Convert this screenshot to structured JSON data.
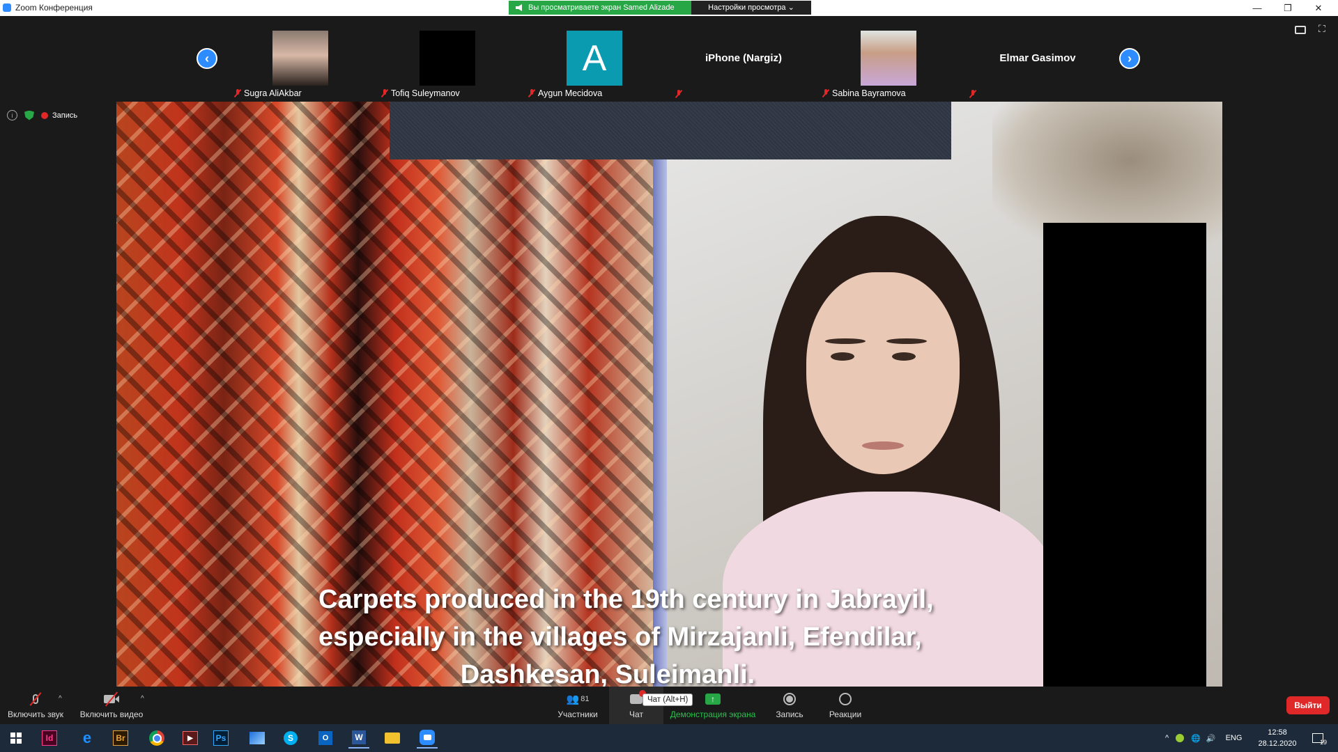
{
  "window": {
    "title": "Zoom Конференция",
    "controls": {
      "minimize": "—",
      "restore": "❐",
      "close": "✕"
    }
  },
  "share_banner": {
    "status": "Вы просматриваете экран Samed Alizade",
    "view_options": "Настройки просмотра ⌄"
  },
  "gallery": {
    "participants": [
      {
        "name": "Sugra AliAkbar",
        "type": "photo"
      },
      {
        "name": "Tofiq Suleymanov",
        "type": "black"
      },
      {
        "name": "Aygun Mecidova",
        "type": "avatar",
        "initial": "A"
      },
      {
        "name": "",
        "big_label": "iPhone (Nargiz)",
        "type": "label"
      },
      {
        "name": "Sabina Bayramova",
        "type": "photo"
      },
      {
        "name": "",
        "big_label": "Elmar Gasimov",
        "type": "label"
      }
    ]
  },
  "status_row": {
    "recording": "Запись"
  },
  "shared_content": {
    "caption_lines": [
      "Carpets produced in the 19th century in Jabrayil,",
      "especially in the villages of Mirzajanli, Efendilar,",
      "Dashkesan, Suleimanli."
    ]
  },
  "toolbar": {
    "unmute": "Включить звук",
    "start_video": "Включить видео",
    "participants": "Участники",
    "participants_count": "81",
    "chat": "Чат",
    "chat_tooltip": "Чат (Alt+H)",
    "share_screen": "Демонстрация экрана",
    "record": "Запись",
    "reactions": "Реакции",
    "leave": "Выйти"
  },
  "taskbar": {
    "apps": [
      "Id",
      "e",
      "Br",
      "Ps",
      "W"
    ],
    "lang": "ENG",
    "time": "12:58",
    "date": "28.12.2020",
    "notifications": "19"
  },
  "colors": {
    "zoom_blue": "#2d8cff",
    "share_green": "#27a745",
    "leave_red": "#e02828"
  }
}
